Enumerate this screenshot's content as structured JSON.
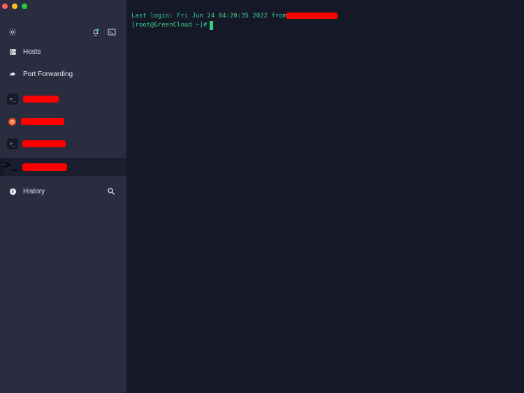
{
  "window": {
    "traffic_lights": {
      "close": "#ff5f57",
      "minimize": "#febc2e",
      "maximize": "#28c840"
    }
  },
  "toolbar": {
    "settings_icon": "gear-icon",
    "notifications_icon": "bell-icon",
    "terminal_icon": "terminal-icon"
  },
  "sidebar": {
    "nav": [
      {
        "label": "Hosts",
        "icon": "server-icon"
      },
      {
        "label": "Port Forwarding",
        "icon": "arrow-right-icon"
      }
    ],
    "sessions": [
      {
        "icon": "terminal-icon",
        "glyph": ">_",
        "redacted": true
      },
      {
        "icon": "ubuntu-icon",
        "redacted": true
      },
      {
        "icon": "terminal-icon",
        "glyph": ">_",
        "redacted": true
      },
      {
        "icon": "terminal-icon",
        "glyph": ">_",
        "redacted": true,
        "active": true
      }
    ],
    "history": {
      "label": "History",
      "icon": "clock-icon",
      "search_icon": "search-icon"
    }
  },
  "terminal": {
    "lines": [
      "Last login: Fri Jun 24 04:20:35 2022 from",
      "[root@GreenCloud ~]#"
    ],
    "text_color": "#3fcf8e",
    "background": "#151827"
  }
}
